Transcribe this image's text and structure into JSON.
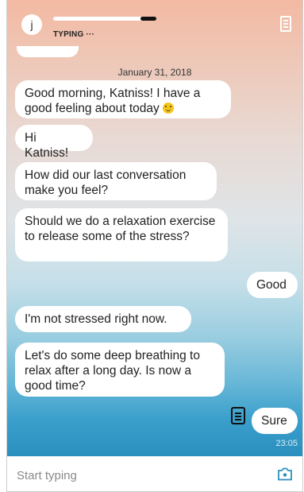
{
  "header": {
    "avatar_letter": "j",
    "status": "TYPING ···"
  },
  "chat": {
    "date": "January 31, 2018",
    "messages": [
      {
        "from": "bot",
        "text": "Good morning, Katniss! I have a good feeling about today"
      },
      {
        "from": "bot",
        "text": "Hi Katniss!"
      },
      {
        "from": "bot",
        "text": "How did our last conversation make you feel?"
      },
      {
        "from": "bot",
        "text": "Should we do a relaxation exercise to release some of the stress?"
      },
      {
        "from": "user",
        "text": "Good"
      },
      {
        "from": "bot",
        "text": "I'm not stressed right now."
      },
      {
        "from": "bot",
        "text": "Let's do some deep breathing to relax after a long day. Is now a good time?"
      },
      {
        "from": "user",
        "text": "Sure"
      }
    ],
    "last_time": "23:05"
  },
  "composer": {
    "placeholder": "Start typing"
  },
  "icons": {
    "emoji": "smiling-face-icon",
    "notes": "notes-icon",
    "camera": "camera-icon",
    "menu_doc": "document-icon"
  },
  "colors": {
    "bubble": "#ffffff",
    "gradient_top": "#f3b9a2",
    "gradient_bottom": "#2a8fbe"
  }
}
